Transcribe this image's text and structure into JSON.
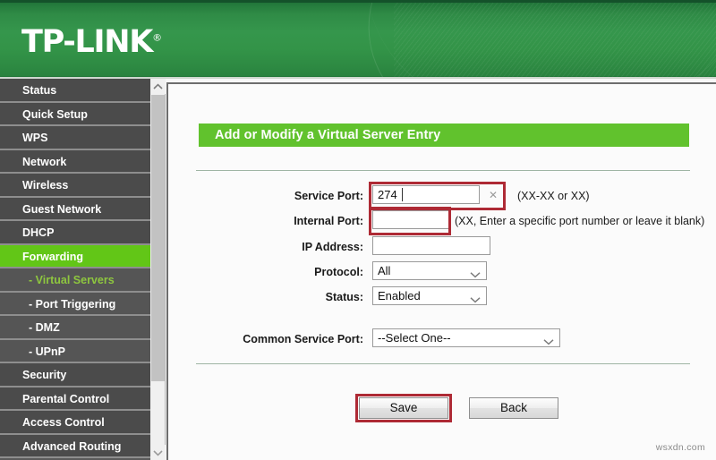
{
  "brand": {
    "name": "TP-LINK",
    "registered": "®"
  },
  "sidebar": {
    "items": [
      {
        "label": "Status",
        "type": "top",
        "state": "normal"
      },
      {
        "label": "Quick Setup",
        "type": "top",
        "state": "normal"
      },
      {
        "label": "WPS",
        "type": "top",
        "state": "normal"
      },
      {
        "label": "Network",
        "type": "top",
        "state": "normal"
      },
      {
        "label": "Wireless",
        "type": "top",
        "state": "normal"
      },
      {
        "label": "Guest Network",
        "type": "top",
        "state": "normal"
      },
      {
        "label": "DHCP",
        "type": "top",
        "state": "normal"
      },
      {
        "label": "Forwarding",
        "type": "top",
        "state": "active"
      },
      {
        "label": "- Virtual Servers",
        "type": "sub",
        "state": "sub-active"
      },
      {
        "label": "- Port Triggering",
        "type": "sub",
        "state": "normal"
      },
      {
        "label": "- DMZ",
        "type": "sub",
        "state": "normal"
      },
      {
        "label": "- UPnP",
        "type": "sub",
        "state": "normal"
      },
      {
        "label": "Security",
        "type": "top",
        "state": "normal"
      },
      {
        "label": "Parental Control",
        "type": "top",
        "state": "normal"
      },
      {
        "label": "Access Control",
        "type": "top",
        "state": "normal"
      },
      {
        "label": "Advanced Routing",
        "type": "top",
        "state": "normal"
      }
    ],
    "scrollbar": {
      "up_icon": "chevron-up-icon",
      "down_icon": "chevron-down-icon"
    }
  },
  "main": {
    "panel_title": "Add or Modify a Virtual Server Entry",
    "fields": {
      "service_port": {
        "label": "Service Port:",
        "value": "274",
        "hint": "(XX-XX or XX)",
        "clear_icon": "clear-x-icon",
        "highlighted": true
      },
      "internal_port": {
        "label": "Internal Port:",
        "value": "",
        "hint": "(XX, Enter a specific port number or leave it blank)",
        "highlighted": true
      },
      "ip_address": {
        "label": "IP Address:",
        "value": "",
        "hint": ""
      },
      "protocol": {
        "label": "Protocol:",
        "value": "All",
        "chevron_icon": "chevron-down-icon"
      },
      "status": {
        "label": "Status:",
        "value": "Enabled",
        "chevron_icon": "chevron-down-icon"
      },
      "common_service_port": {
        "label": "Common Service Port:",
        "value": "--Select One--",
        "chevron_icon": "chevron-down-icon"
      }
    },
    "buttons": {
      "save": "Save",
      "back": "Back"
    }
  },
  "watermark": "wsxdn.com",
  "colors": {
    "header_green": "#2f8b46",
    "accent_green": "#61c22d",
    "sub_active_green": "#8ec63f",
    "sidebar_dark": "#4b4b4b",
    "annotation_red": "#ae2a35"
  }
}
